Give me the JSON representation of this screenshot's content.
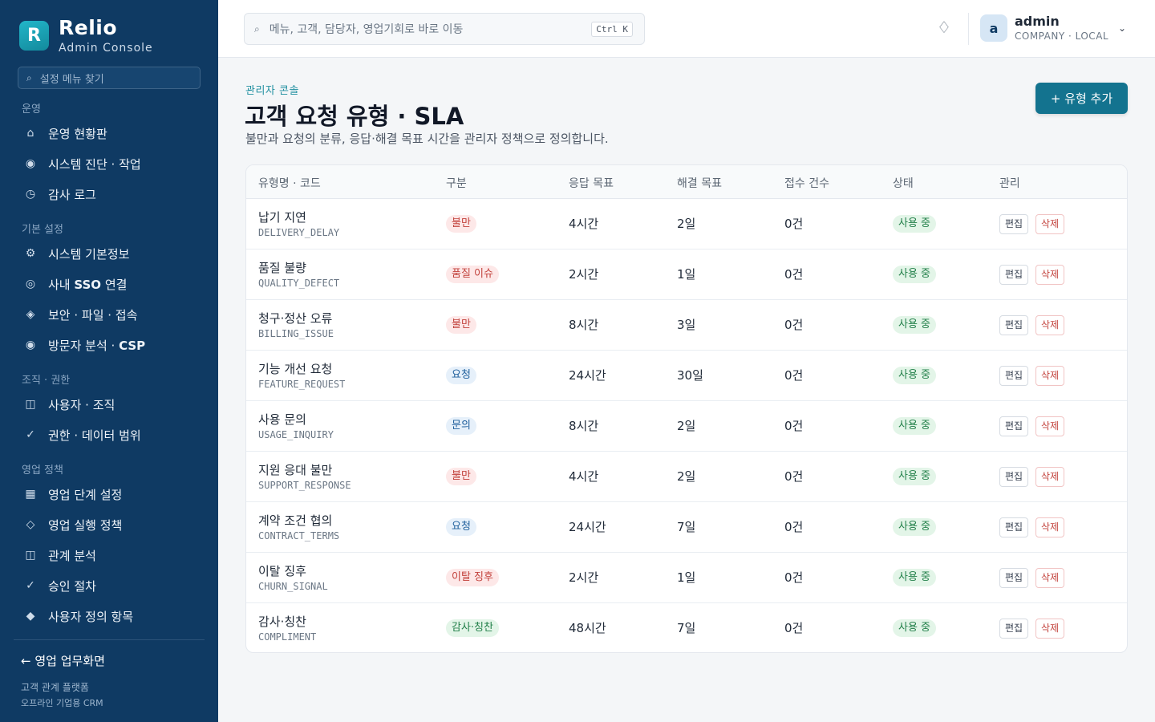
{
  "brand": {
    "logo_letter": "R",
    "name": "Relio",
    "subtitle": "Admin Console"
  },
  "sidebar": {
    "search_placeholder": "설정 메뉴 찾기",
    "sections": [
      {
        "label": "운영",
        "items": [
          {
            "icon": "home-icon",
            "glyph": "⌂",
            "label": "운영 현황판"
          },
          {
            "icon": "target-icon",
            "glyph": "◉",
            "label": "시스템 진단 · 작업"
          },
          {
            "icon": "clock-icon",
            "glyph": "◷",
            "label": "감사 로그"
          }
        ]
      },
      {
        "label": "기본 설정",
        "items": [
          {
            "icon": "gear-icon",
            "glyph": "⚙",
            "label": "시스템 기본정보"
          },
          {
            "icon": "circle-icon",
            "glyph": "◎",
            "label_pre": "사내 ",
            "label_bold": "SSO",
            "label_post": " 연결"
          },
          {
            "icon": "diamond-icon",
            "glyph": "◈",
            "label": "보안 · 파일 · 접속"
          },
          {
            "icon": "target-icon",
            "glyph": "◉",
            "label_pre": "방문자 분석 · ",
            "label_bold": "CSP",
            "label_post": ""
          }
        ]
      },
      {
        "label": "조직 · 권한",
        "items": [
          {
            "icon": "panel-icon",
            "glyph": "◫",
            "label": "사용자 · 조직"
          },
          {
            "icon": "check-icon",
            "glyph": "✓",
            "label": "권한 · 데이터 범위"
          }
        ]
      },
      {
        "label": "영업 정책",
        "items": [
          {
            "icon": "grid-icon",
            "glyph": "▦",
            "label": "영업 단계 설정"
          },
          {
            "icon": "diamond-outline-icon",
            "glyph": "◇",
            "label": "영업 실행 정책"
          },
          {
            "icon": "panel-icon",
            "glyph": "◫",
            "label": "관계 분석"
          },
          {
            "icon": "check-icon",
            "glyph": "✓",
            "label": "승인 절차"
          },
          {
            "icon": "diamond-filled-icon",
            "glyph": "◆",
            "label": "사용자 정의 항목"
          }
        ]
      }
    ],
    "back_link": "← 영업 업무화면",
    "footer_line1": "고객 관계 플랫폼",
    "footer_line2": "오프라인 기업용 CRM"
  },
  "topbar": {
    "search_placeholder": "메뉴, 고객, 담당자, 영업기회로 바로 이동",
    "shortcut": "Ctrl K",
    "notification_glyph": "♢",
    "user": {
      "avatar_letter": "a",
      "name": "admin",
      "role": "COMPANY · LOCAL"
    }
  },
  "page": {
    "breadcrumb": "관리자 콘솔",
    "title_main": "고객 요청 유형 · ",
    "title_bold": "SLA",
    "description": "불만과 요청의 분류, 응답·해결 목표 시간을 관리자 정책으로 정의합니다.",
    "add_button": "+ 유형 추가"
  },
  "table": {
    "headers": [
      "유형명 · 코드",
      "구분",
      "응답 목표",
      "해결 목표",
      "접수 건수",
      "상태",
      "관리"
    ],
    "edit_label": "편집",
    "delete_label": "삭제",
    "rows": [
      {
        "name": "납기 지연",
        "code": "DELIVERY_DELAY",
        "category": "불만",
        "category_type": "complaint",
        "response": "4시간",
        "resolution": "2일",
        "count": "0건",
        "status": "사용 중"
      },
      {
        "name": "품질 불량",
        "code": "QUALITY_DEFECT",
        "category": "품질 이슈",
        "category_type": "complaint",
        "response": "2시간",
        "resolution": "1일",
        "count": "0건",
        "status": "사용 중"
      },
      {
        "name": "청구·정산 오류",
        "code": "BILLING_ISSUE",
        "category": "불만",
        "category_type": "complaint",
        "response": "8시간",
        "resolution": "3일",
        "count": "0건",
        "status": "사용 중"
      },
      {
        "name": "기능 개선 요청",
        "code": "FEATURE_REQUEST",
        "category": "요청",
        "category_type": "request",
        "response": "24시간",
        "resolution": "30일",
        "count": "0건",
        "status": "사용 중"
      },
      {
        "name": "사용 문의",
        "code": "USAGE_INQUIRY",
        "category": "문의",
        "category_type": "request",
        "response": "8시간",
        "resolution": "2일",
        "count": "0건",
        "status": "사용 중"
      },
      {
        "name": "지원 응대 불만",
        "code": "SUPPORT_RESPONSE",
        "category": "불만",
        "category_type": "complaint",
        "response": "4시간",
        "resolution": "2일",
        "count": "0건",
        "status": "사용 중"
      },
      {
        "name": "계약 조건 협의",
        "code": "CONTRACT_TERMS",
        "category": "요청",
        "category_type": "request",
        "response": "24시간",
        "resolution": "7일",
        "count": "0건",
        "status": "사용 중"
      },
      {
        "name": "이탈 징후",
        "code": "CHURN_SIGNAL",
        "category": "이탈 징후",
        "category_type": "complaint",
        "response": "2시간",
        "resolution": "1일",
        "count": "0건",
        "status": "사용 중"
      },
      {
        "name": "감사·칭찬",
        "code": "COMPLIMENT",
        "category": "감사·칭찬",
        "category_type": "praise",
        "response": "48시간",
        "resolution": "7일",
        "count": "0건",
        "status": "사용 중"
      }
    ]
  },
  "colors": {
    "sidebar_bg": "#0f3a63",
    "accent": "#13738f",
    "logo": "#22b6c9",
    "complaint": "#c2413b",
    "request": "#1f5f9c",
    "active": "#23804a"
  }
}
